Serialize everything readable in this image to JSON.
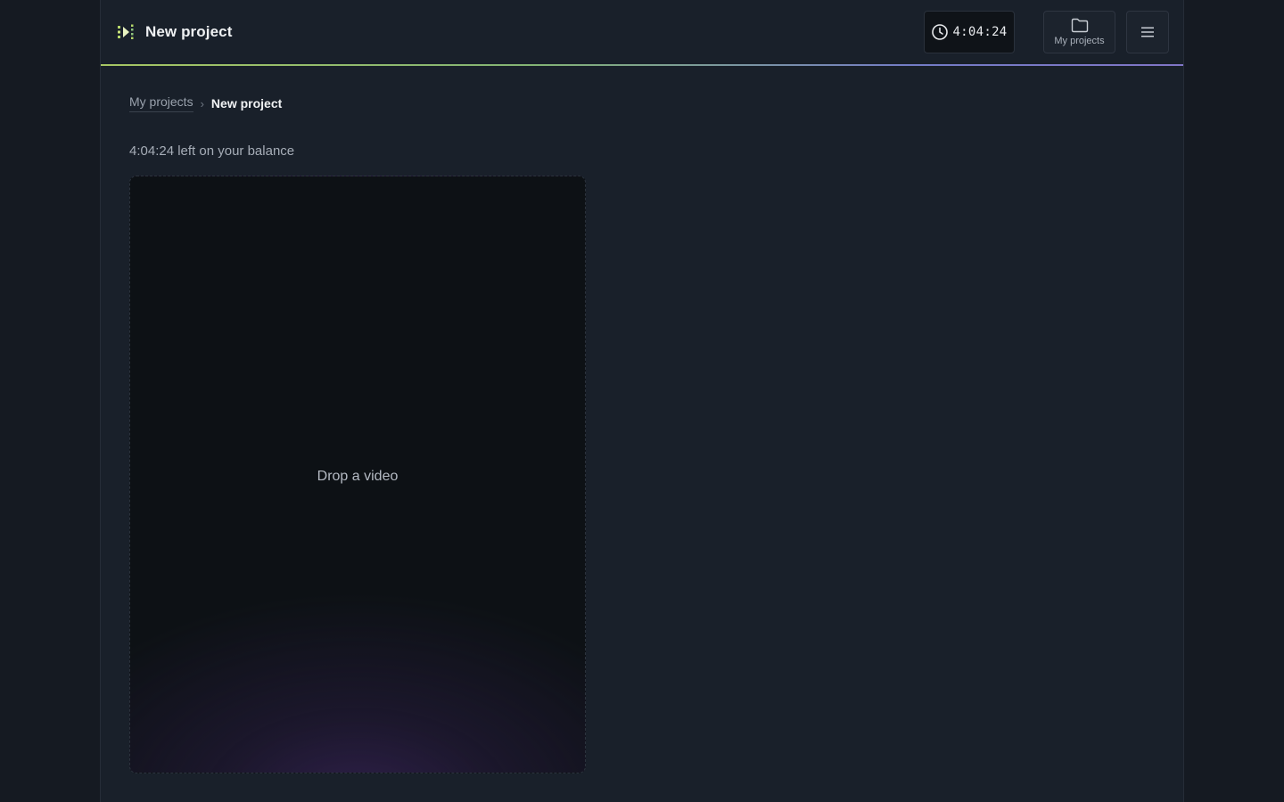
{
  "header": {
    "title": "New project",
    "logo_icon": "play-chevrons-logo-icon",
    "accent_color": "#b6d86a",
    "timer": {
      "icon": "clock-icon",
      "value": "4:04:24"
    },
    "projects_button": {
      "icon": "folder-icon",
      "label": "My projects"
    },
    "menu_button": {
      "icon": "hamburger-menu-icon"
    }
  },
  "breadcrumb": {
    "parent": "My projects",
    "separator": "›",
    "current": "New project"
  },
  "main": {
    "balance_text": "4:04:24 left on your balance",
    "dropzone_label": "Drop a video"
  }
}
